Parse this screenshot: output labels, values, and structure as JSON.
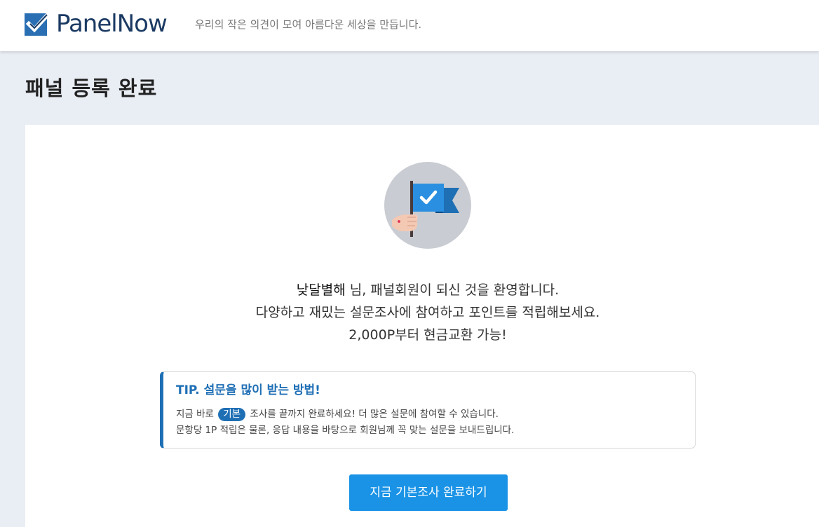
{
  "header": {
    "logo_text": "PanelNow",
    "tagline": "우리의 작은 의견이 모여 아름다운 세상을 만듭니다."
  },
  "page": {
    "title": "패널 등록 완료"
  },
  "welcome": {
    "nickname": "낮달별해",
    "line1_suffix": " 님, 패널회원이 되신 것을 환영합니다.",
    "line2": "다양하고 재밌는 설문조사에 참여하고 포인트를 적립해보세요.",
    "line3": "2,000P부터 현금교환 가능!"
  },
  "tip": {
    "title": "TIP. 설문을 많이 받는 방법!",
    "line1_before": "지금 바로 ",
    "badge": "기본",
    "line1_after": " 조사를 끝까지 완료하세요! 더 많은 설문에 참여할 수 있습니다.",
    "line2": "문항당 1P 적립은 물론, 응답 내용을 바탕으로 회원님께 꼭 맞는 설문을 보내드립니다."
  },
  "cta": {
    "label": "지금 기본조사 완료하기"
  },
  "colors": {
    "brand_navy": "#1b3a63",
    "brand_blue": "#1f6fb5",
    "cta_blue": "#1a93e6",
    "page_bg": "#e9edf4"
  },
  "icons": {
    "logo": "check-square-icon",
    "illustration": "flag-check-icon"
  }
}
